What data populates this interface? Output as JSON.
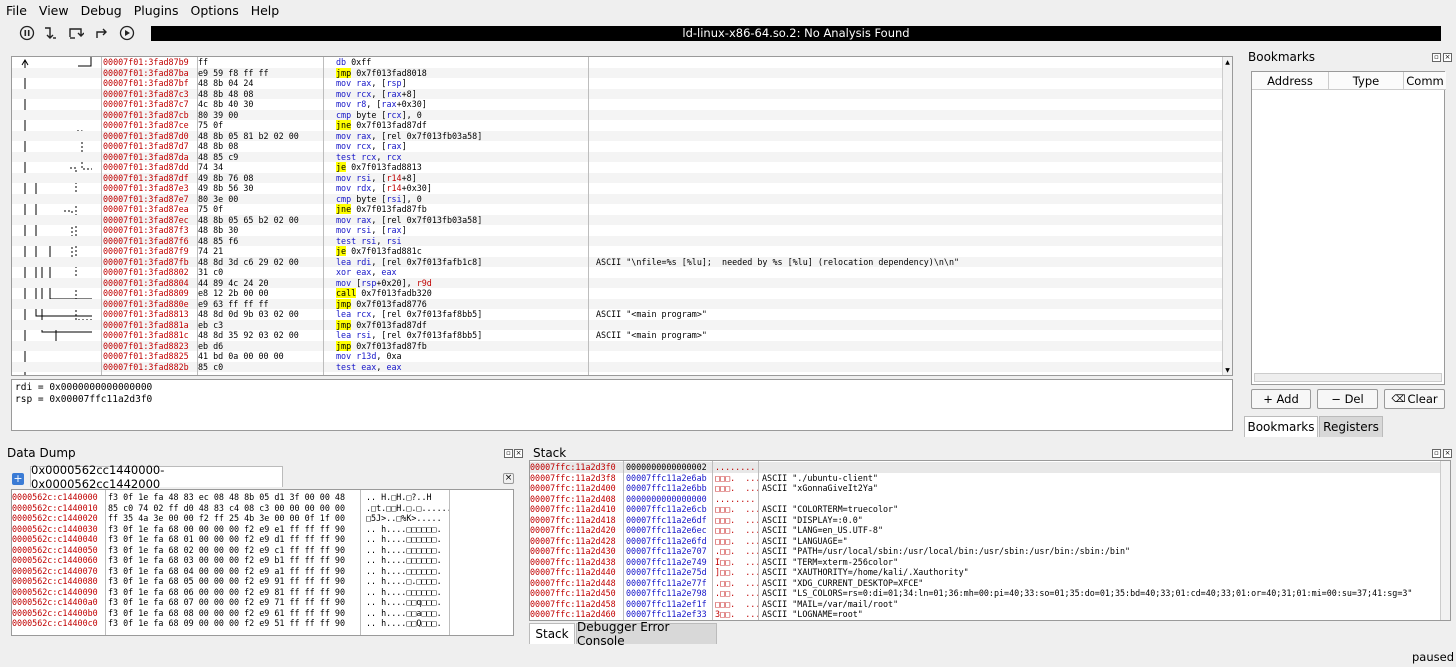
{
  "menu": [
    "File",
    "View",
    "Debug",
    "Plugins",
    "Options",
    "Help"
  ],
  "status_title": "ld-linux-x86-64.so.2: No Analysis Found",
  "disasm": [
    {
      "addr": "00007f01:3fad87b9",
      "bytes": "ff",
      "mn": "db",
      "ops": "0xff",
      "hl": false,
      "cmt": ""
    },
    {
      "addr": "00007f01:3fad87ba",
      "bytes": "e9 59 f8 ff ff",
      "mn": "jmp",
      "ops": "0x7f013fad8018",
      "hl": true,
      "cmt": ""
    },
    {
      "addr": "00007f01:3fad87bf",
      "bytes": "48 8b 04 24",
      "mn": "mov",
      "ops": "rax, [rsp]",
      "hl": false,
      "cmt": ""
    },
    {
      "addr": "00007f01:3fad87c3",
      "bytes": "48 8b 48 08",
      "mn": "mov",
      "ops": "rcx, [rax+8]",
      "hl": false,
      "cmt": ""
    },
    {
      "addr": "00007f01:3fad87c7",
      "bytes": "4c 8b 40 30",
      "mn": "mov",
      "ops": "r8, [rax+0x30]",
      "hl": false,
      "cmt": ""
    },
    {
      "addr": "00007f01:3fad87cb",
      "bytes": "80 39 00",
      "mn": "cmp",
      "ops": "byte [rcx], 0",
      "hl": false,
      "cmt": ""
    },
    {
      "addr": "00007f01:3fad87ce",
      "bytes": "75 0f",
      "mn": "jne",
      "ops": "0x7f013fad87df",
      "hl": true,
      "cmt": ""
    },
    {
      "addr": "00007f01:3fad87d0",
      "bytes": "48 8b 05 81 b2 02 00",
      "mn": "mov",
      "ops": "rax, [rel 0x7f013fb03a58]",
      "hl": false,
      "cmt": ""
    },
    {
      "addr": "00007f01:3fad87d7",
      "bytes": "48 8b 08",
      "mn": "mov",
      "ops": "rcx, [rax]",
      "hl": false,
      "cmt": ""
    },
    {
      "addr": "00007f01:3fad87da",
      "bytes": "48 85 c9",
      "mn": "test",
      "ops": "rcx, rcx",
      "hl": false,
      "cmt": ""
    },
    {
      "addr": "00007f01:3fad87dd",
      "bytes": "74 34",
      "mn": "je",
      "ops": "0x7f013fad8813",
      "hl": true,
      "cmt": ""
    },
    {
      "addr": "00007f01:3fad87df",
      "bytes": "49 8b 76 08",
      "mn": "mov",
      "ops": "rsi, [r14+8]",
      "hl": false,
      "cmt": ""
    },
    {
      "addr": "00007f01:3fad87e3",
      "bytes": "49 8b 56 30",
      "mn": "mov",
      "ops": "rdx, [r14+0x30]",
      "hl": false,
      "cmt": ""
    },
    {
      "addr": "00007f01:3fad87e7",
      "bytes": "80 3e 00",
      "mn": "cmp",
      "ops": "byte [rsi], 0",
      "hl": false,
      "cmt": ""
    },
    {
      "addr": "00007f01:3fad87ea",
      "bytes": "75 0f",
      "mn": "jne",
      "ops": "0x7f013fad87fb",
      "hl": true,
      "cmt": ""
    },
    {
      "addr": "00007f01:3fad87ec",
      "bytes": "48 8b 05 65 b2 02 00",
      "mn": "mov",
      "ops": "rax, [rel 0x7f013fb03a58]",
      "hl": false,
      "cmt": ""
    },
    {
      "addr": "00007f01:3fad87f3",
      "bytes": "48 8b 30",
      "mn": "mov",
      "ops": "rsi, [rax]",
      "hl": false,
      "cmt": ""
    },
    {
      "addr": "00007f01:3fad87f6",
      "bytes": "48 85 f6",
      "mn": "test",
      "ops": "rsi, rsi",
      "hl": false,
      "cmt": ""
    },
    {
      "addr": "00007f01:3fad87f9",
      "bytes": "74 21",
      "mn": "je",
      "ops": "0x7f013fad881c",
      "hl": true,
      "cmt": ""
    },
    {
      "addr": "00007f01:3fad87fb",
      "bytes": "48 8d 3d c6 29 02 00",
      "mn": "lea",
      "ops": "rdi, [rel 0x7f013fafb1c8]",
      "hl": false,
      "cmt": "ASCII \"\\nfile=%s [%lu];  needed by %s [%lu] (relocation dependency)\\n\\n\""
    },
    {
      "addr": "00007f01:3fad8802",
      "bytes": "31 c0",
      "mn": "xor",
      "ops": "eax, eax",
      "hl": false,
      "cmt": ""
    },
    {
      "addr": "00007f01:3fad8804",
      "bytes": "44 89 4c 24 20",
      "mn": "mov",
      "ops": "[rsp+0x20], r9d",
      "hl": false,
      "cmt": ""
    },
    {
      "addr": "00007f01:3fad8809",
      "bytes": "e8 12 2b 00 00",
      "mn": "call",
      "ops": "0x7f013fadb320",
      "hl": true,
      "cmt": ""
    },
    {
      "addr": "00007f01:3fad880e",
      "bytes": "e9 63 ff ff ff",
      "mn": "jmp",
      "ops": "0x7f013fad8776",
      "hl": true,
      "cmt": ""
    },
    {
      "addr": "00007f01:3fad8813",
      "bytes": "48 8d 0d 9b 03 02 00",
      "mn": "lea",
      "ops": "rcx, [rel 0x7f013faf8bb5]",
      "hl": false,
      "cmt": "ASCII \"<main program>\""
    },
    {
      "addr": "00007f01:3fad881a",
      "bytes": "eb c3",
      "mn": "jmp",
      "ops": "0x7f013fad87df",
      "hl": true,
      "cmt": ""
    },
    {
      "addr": "00007f01:3fad881c",
      "bytes": "48 8d 35 92 03 02 00",
      "mn": "lea",
      "ops": "rsi, [rel 0x7f013faf8bb5]",
      "hl": false,
      "cmt": "ASCII \"<main program>\""
    },
    {
      "addr": "00007f01:3fad8823",
      "bytes": "eb d6",
      "mn": "jmp",
      "ops": "0x7f013fad87fb",
      "hl": true,
      "cmt": ""
    },
    {
      "addr": "00007f01:3fad8825",
      "bytes": "41 bd 0a 00 00 00",
      "mn": "mov",
      "ops": "r13d, 0xa",
      "hl": false,
      "cmt": ""
    },
    {
      "addr": "00007f01:3fad882b",
      "bytes": "85 c0",
      "mn": "test",
      "ops": "eax, eax",
      "hl": false,
      "cmt": ""
    }
  ],
  "registers": [
    "rdi = 0x0000000000000000",
    "rsp = 0x00007ffc11a2d3f0"
  ],
  "bookmarks": {
    "title": "Bookmarks",
    "columns": [
      "Address",
      "Type",
      "Comm"
    ],
    "add": "+ Add",
    "del": "− Del",
    "clear": "Clear"
  },
  "right_tabs": [
    "Bookmarks",
    "Registers"
  ],
  "datadump": {
    "title": "Data Dump",
    "tab": "0x0000562cc1440000-0x0000562cc1442000",
    "rows": [
      {
        "a": "0000562c:c1440000",
        "h": "f3 0f 1e fa 48 83 ec 08 48 8b 05 d1 3f 00 00 48",
        "s": ".. H.□H.□?..H"
      },
      {
        "a": "0000562c:c1440010",
        "h": "85 c0 74 02 ff d0 48 83 c4 08 c3 00 00 00 00 00",
        "s": ".□t.□□H.□.□......"
      },
      {
        "a": "0000562c:c1440020",
        "h": "ff 35 4a 3e 00 00 f2 ff 25 4b 3e 00 00 0f 1f 00",
        "s": "□5J>..□%K>....."
      },
      {
        "a": "0000562c:c1440030",
        "h": "f3 0f 1e fa 68 00 00 00 00 f2 e9 e1 ff ff ff 90",
        "s": ".. h....□□□□□□."
      },
      {
        "a": "0000562c:c1440040",
        "h": "f3 0f 1e fa 68 01 00 00 00 f2 e9 d1 ff ff ff 90",
        "s": ".. h....□□□□□□."
      },
      {
        "a": "0000562c:c1440050",
        "h": "f3 0f 1e fa 68 02 00 00 00 f2 e9 c1 ff ff ff 90",
        "s": ".. h....□□□□□□."
      },
      {
        "a": "0000562c:c1440060",
        "h": "f3 0f 1e fa 68 03 00 00 00 f2 e9 b1 ff ff ff 90",
        "s": ".. h....□□□□□□."
      },
      {
        "a": "0000562c:c1440070",
        "h": "f3 0f 1e fa 68 04 00 00 00 f2 e9 a1 ff ff ff 90",
        "s": ".. h....□□□□□□."
      },
      {
        "a": "0000562c:c1440080",
        "h": "f3 0f 1e fa 68 05 00 00 00 f2 e9 91 ff ff ff 90",
        "s": ".. h....□.□□□□."
      },
      {
        "a": "0000562c:c1440090",
        "h": "f3 0f 1e fa 68 06 00 00 00 f2 e9 81 ff ff ff 90",
        "s": ".. h....□□□□□□."
      },
      {
        "a": "0000562c:c14400a0",
        "h": "f3 0f 1e fa 68 07 00 00 00 f2 e9 71 ff ff ff 90",
        "s": ".. h....□□q□□□."
      },
      {
        "a": "0000562c:c14400b0",
        "h": "f3 0f 1e fa 68 08 00 00 00 f2 e9 61 ff ff ff 90",
        "s": ".. h....□□a□□□."
      },
      {
        "a": "0000562c:c14400c0",
        "h": "f3 0f 1e fa 68 09 00 00 00 f2 e9 51 ff ff ff 90",
        "s": ".. h....□□Q□□□."
      }
    ]
  },
  "stack": {
    "title": "Stack",
    "rows": [
      {
        "a": "00007ffc:11a2d3f0",
        "v": "0000000000000002",
        "s": "........",
        "c": ""
      },
      {
        "a": "00007ffc:11a2d3f8",
        "v": "00007ffc11a2e6ab",
        "s": "□□□.  ...",
        "c": "ASCII \"./ubuntu-client\""
      },
      {
        "a": "00007ffc:11a2d400",
        "v": "00007ffc11a2e6bb",
        "s": "□□□.  ...",
        "c": "ASCII \"xGonnaGiveIt2Ya\""
      },
      {
        "a": "00007ffc:11a2d408",
        "v": "0000000000000000",
        "s": "........",
        "c": ""
      },
      {
        "a": "00007ffc:11a2d410",
        "v": "00007ffc11a2e6cb",
        "s": "□□□.  ...",
        "c": "ASCII \"COLORTERM=truecolor\""
      },
      {
        "a": "00007ffc:11a2d418",
        "v": "00007ffc11a2e6df",
        "s": "□□□.  ...",
        "c": "ASCII \"DISPLAY=:0.0\""
      },
      {
        "a": "00007ffc:11a2d420",
        "v": "00007ffc11a2e6ec",
        "s": "□□□.  ...",
        "c": "ASCII \"LANG=en_US.UTF-8\""
      },
      {
        "a": "00007ffc:11a2d428",
        "v": "00007ffc11a2e6fd",
        "s": "□□□.  ...",
        "c": "ASCII \"LANGUAGE=\""
      },
      {
        "a": "00007ffc:11a2d430",
        "v": "00007ffc11a2e707",
        "s": ".□□.  ...",
        "c": "ASCII \"PATH=/usr/local/sbin:/usr/local/bin:/usr/sbin:/usr/bin:/sbin:/bin\""
      },
      {
        "a": "00007ffc:11a2d438",
        "v": "00007ffc11a2e749",
        "s": "I□□.  ...",
        "c": "ASCII \"TERM=xterm-256color\""
      },
      {
        "a": "00007ffc:11a2d440",
        "v": "00007ffc11a2e75d",
        "s": "]□□.  ...",
        "c": "ASCII \"XAUTHORITY=/home/kali/.Xauthority\""
      },
      {
        "a": "00007ffc:11a2d448",
        "v": "00007ffc11a2e77f",
        "s": ".□□.  ...",
        "c": "ASCII \"XDG_CURRENT_DESKTOP=XFCE\""
      },
      {
        "a": "00007ffc:11a2d450",
        "v": "00007ffc11a2e798",
        "s": ".□□.  ...",
        "c": "ASCII \"LS_COLORS=rs=0:di=01;34:ln=01;36:mh=00:pi=40;33:so=01;35:do=01;35:bd=40;33;01:cd=40;33;01:or=40;31;01:mi=00:su=37;41:sg=3\""
      },
      {
        "a": "00007ffc:11a2d458",
        "v": "00007ffc11a2ef1f",
        "s": "□□□.  ...",
        "c": "ASCII \"MAIL=/var/mail/root\""
      },
      {
        "a": "00007ffc:11a2d460",
        "v": "00007ffc11a2ef33",
        "s": "3□□.  ...",
        "c": "ASCII \"LOGNAME=root\""
      }
    ]
  },
  "bottom_tabs": [
    "Stack",
    "Debugger Error Console"
  ],
  "status_bar": "paused"
}
